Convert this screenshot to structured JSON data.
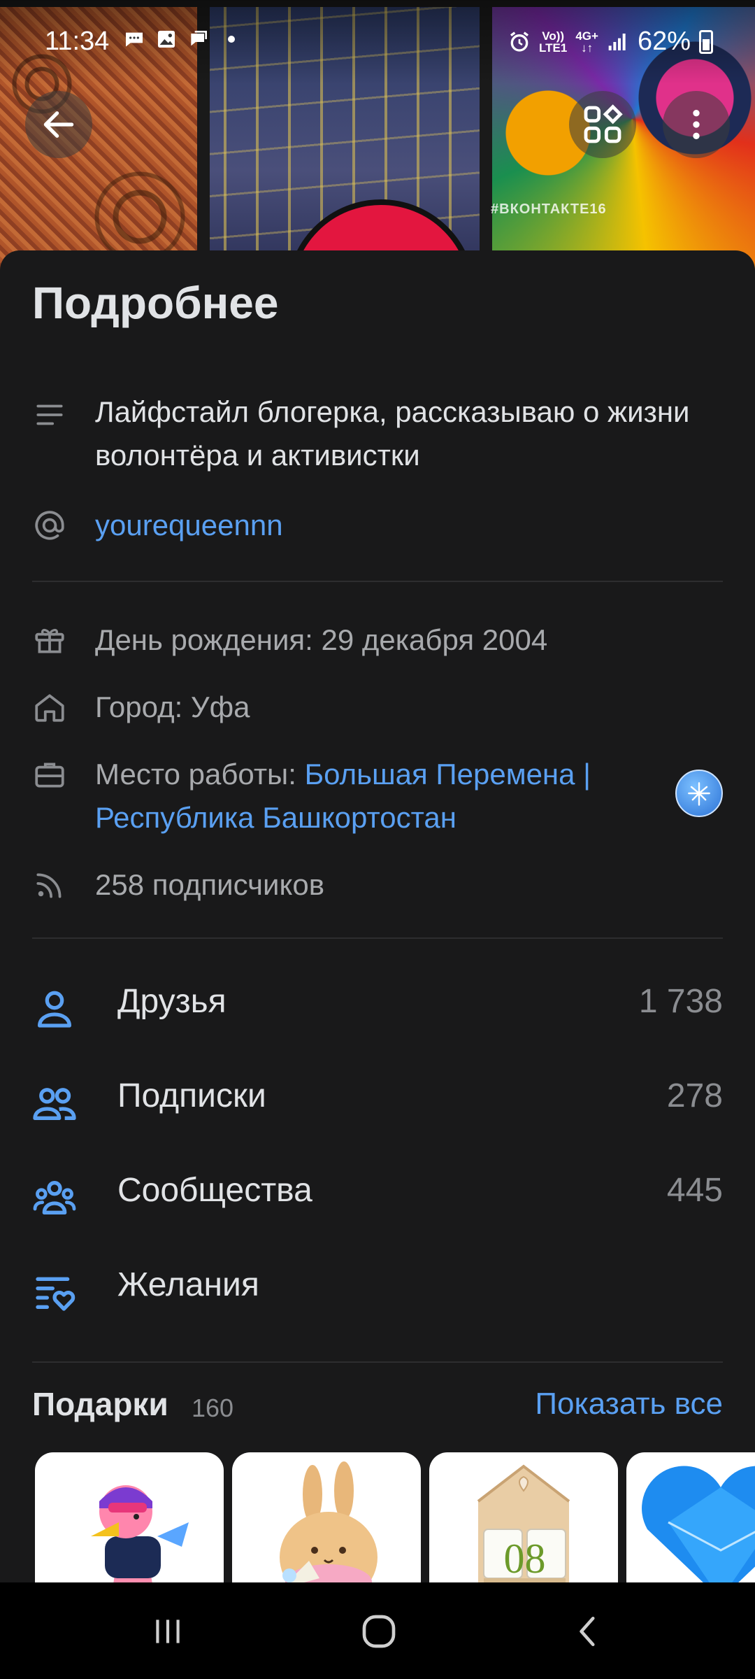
{
  "status_bar": {
    "time": "11:34",
    "network_top": "Vo))",
    "network_bottom": "LTE1",
    "net2_top": "4G+",
    "battery": "62%"
  },
  "banner": {
    "hashtag": "#ВКОНТАКТЕ16"
  },
  "sheet": {
    "title": "Подробнее",
    "about": "Лайфстайл блогерка, рассказываю о жизни волонтёра и активистки",
    "username": "yourequeennn",
    "birthday": "День рождения: 29 декабря 2004",
    "city": "Город: Уфа",
    "work_prefix": "Место работы: ",
    "work_link": "Большая Перемена | Республика Башкортостан",
    "followers": "258 подписчиков"
  },
  "counters": [
    {
      "label": "Друзья",
      "value": "1 738",
      "icon": "person-icon"
    },
    {
      "label": "Подписки",
      "value": "278",
      "icon": "people-icon"
    },
    {
      "label": "Сообщества",
      "value": "445",
      "icon": "community-icon"
    },
    {
      "label": "Желания",
      "value": "",
      "icon": "wishlist-icon"
    }
  ],
  "gifts": {
    "title": "Подарки",
    "count": "160",
    "show_all": "Показать все",
    "cube_digits": "08"
  },
  "colors": {
    "background": "#19191a",
    "accent": "#5aa0f2",
    "text": "#e1e3e6",
    "muted": "#8b8d91"
  }
}
